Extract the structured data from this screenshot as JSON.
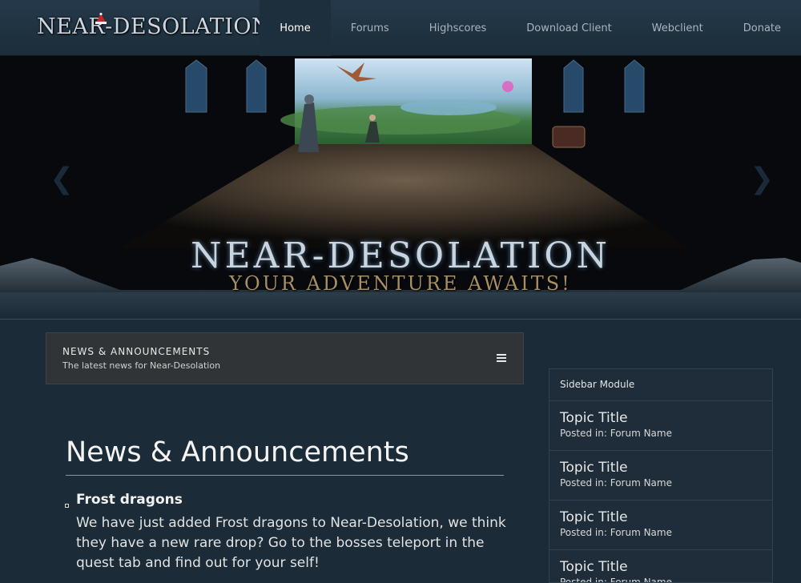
{
  "header": {
    "logo_text": "NEAR-DESOLATION",
    "nav": [
      {
        "label": "Home",
        "active": true
      },
      {
        "label": "Forums"
      },
      {
        "label": "Highscores"
      },
      {
        "label": "Download Client"
      },
      {
        "label": "Webclient"
      },
      {
        "label": "Donate"
      }
    ]
  },
  "hero": {
    "title": "NEAR-DESOLATION",
    "subtitle": "YOUR ADVENTURE AWAITS!",
    "prev_icon": "chevron-left-icon",
    "next_icon": "chevron-right-icon"
  },
  "news_bar": {
    "title": "NEWS & ANNOUNCEMENTS",
    "subtitle": "The latest news for Near-Desolation",
    "menu_icon": "hamburger-menu-icon"
  },
  "content": {
    "heading": "News & Announcements",
    "posts": [
      {
        "title": "Frost dragons",
        "body": "We have just added Frost dragons to Near-Desolation, we think they have a new rare drop? Go to the bosses teleport in the quest tab and find out for your self!"
      }
    ]
  },
  "sidebar": {
    "title": "Sidebar Module",
    "items": [
      {
        "topic": "Topic Title",
        "meta": "Posted in: Forum Name"
      },
      {
        "topic": "Topic Title",
        "meta": "Posted in: Forum Name"
      },
      {
        "topic": "Topic Title",
        "meta": "Posted in: Forum Name"
      },
      {
        "topic": "Topic Title",
        "meta": "Posted in: Forum Name"
      }
    ]
  },
  "colors": {
    "nav_bg": "#24394a",
    "panel_bg": "#303436",
    "sidebar_bg": "#1e2d39"
  }
}
